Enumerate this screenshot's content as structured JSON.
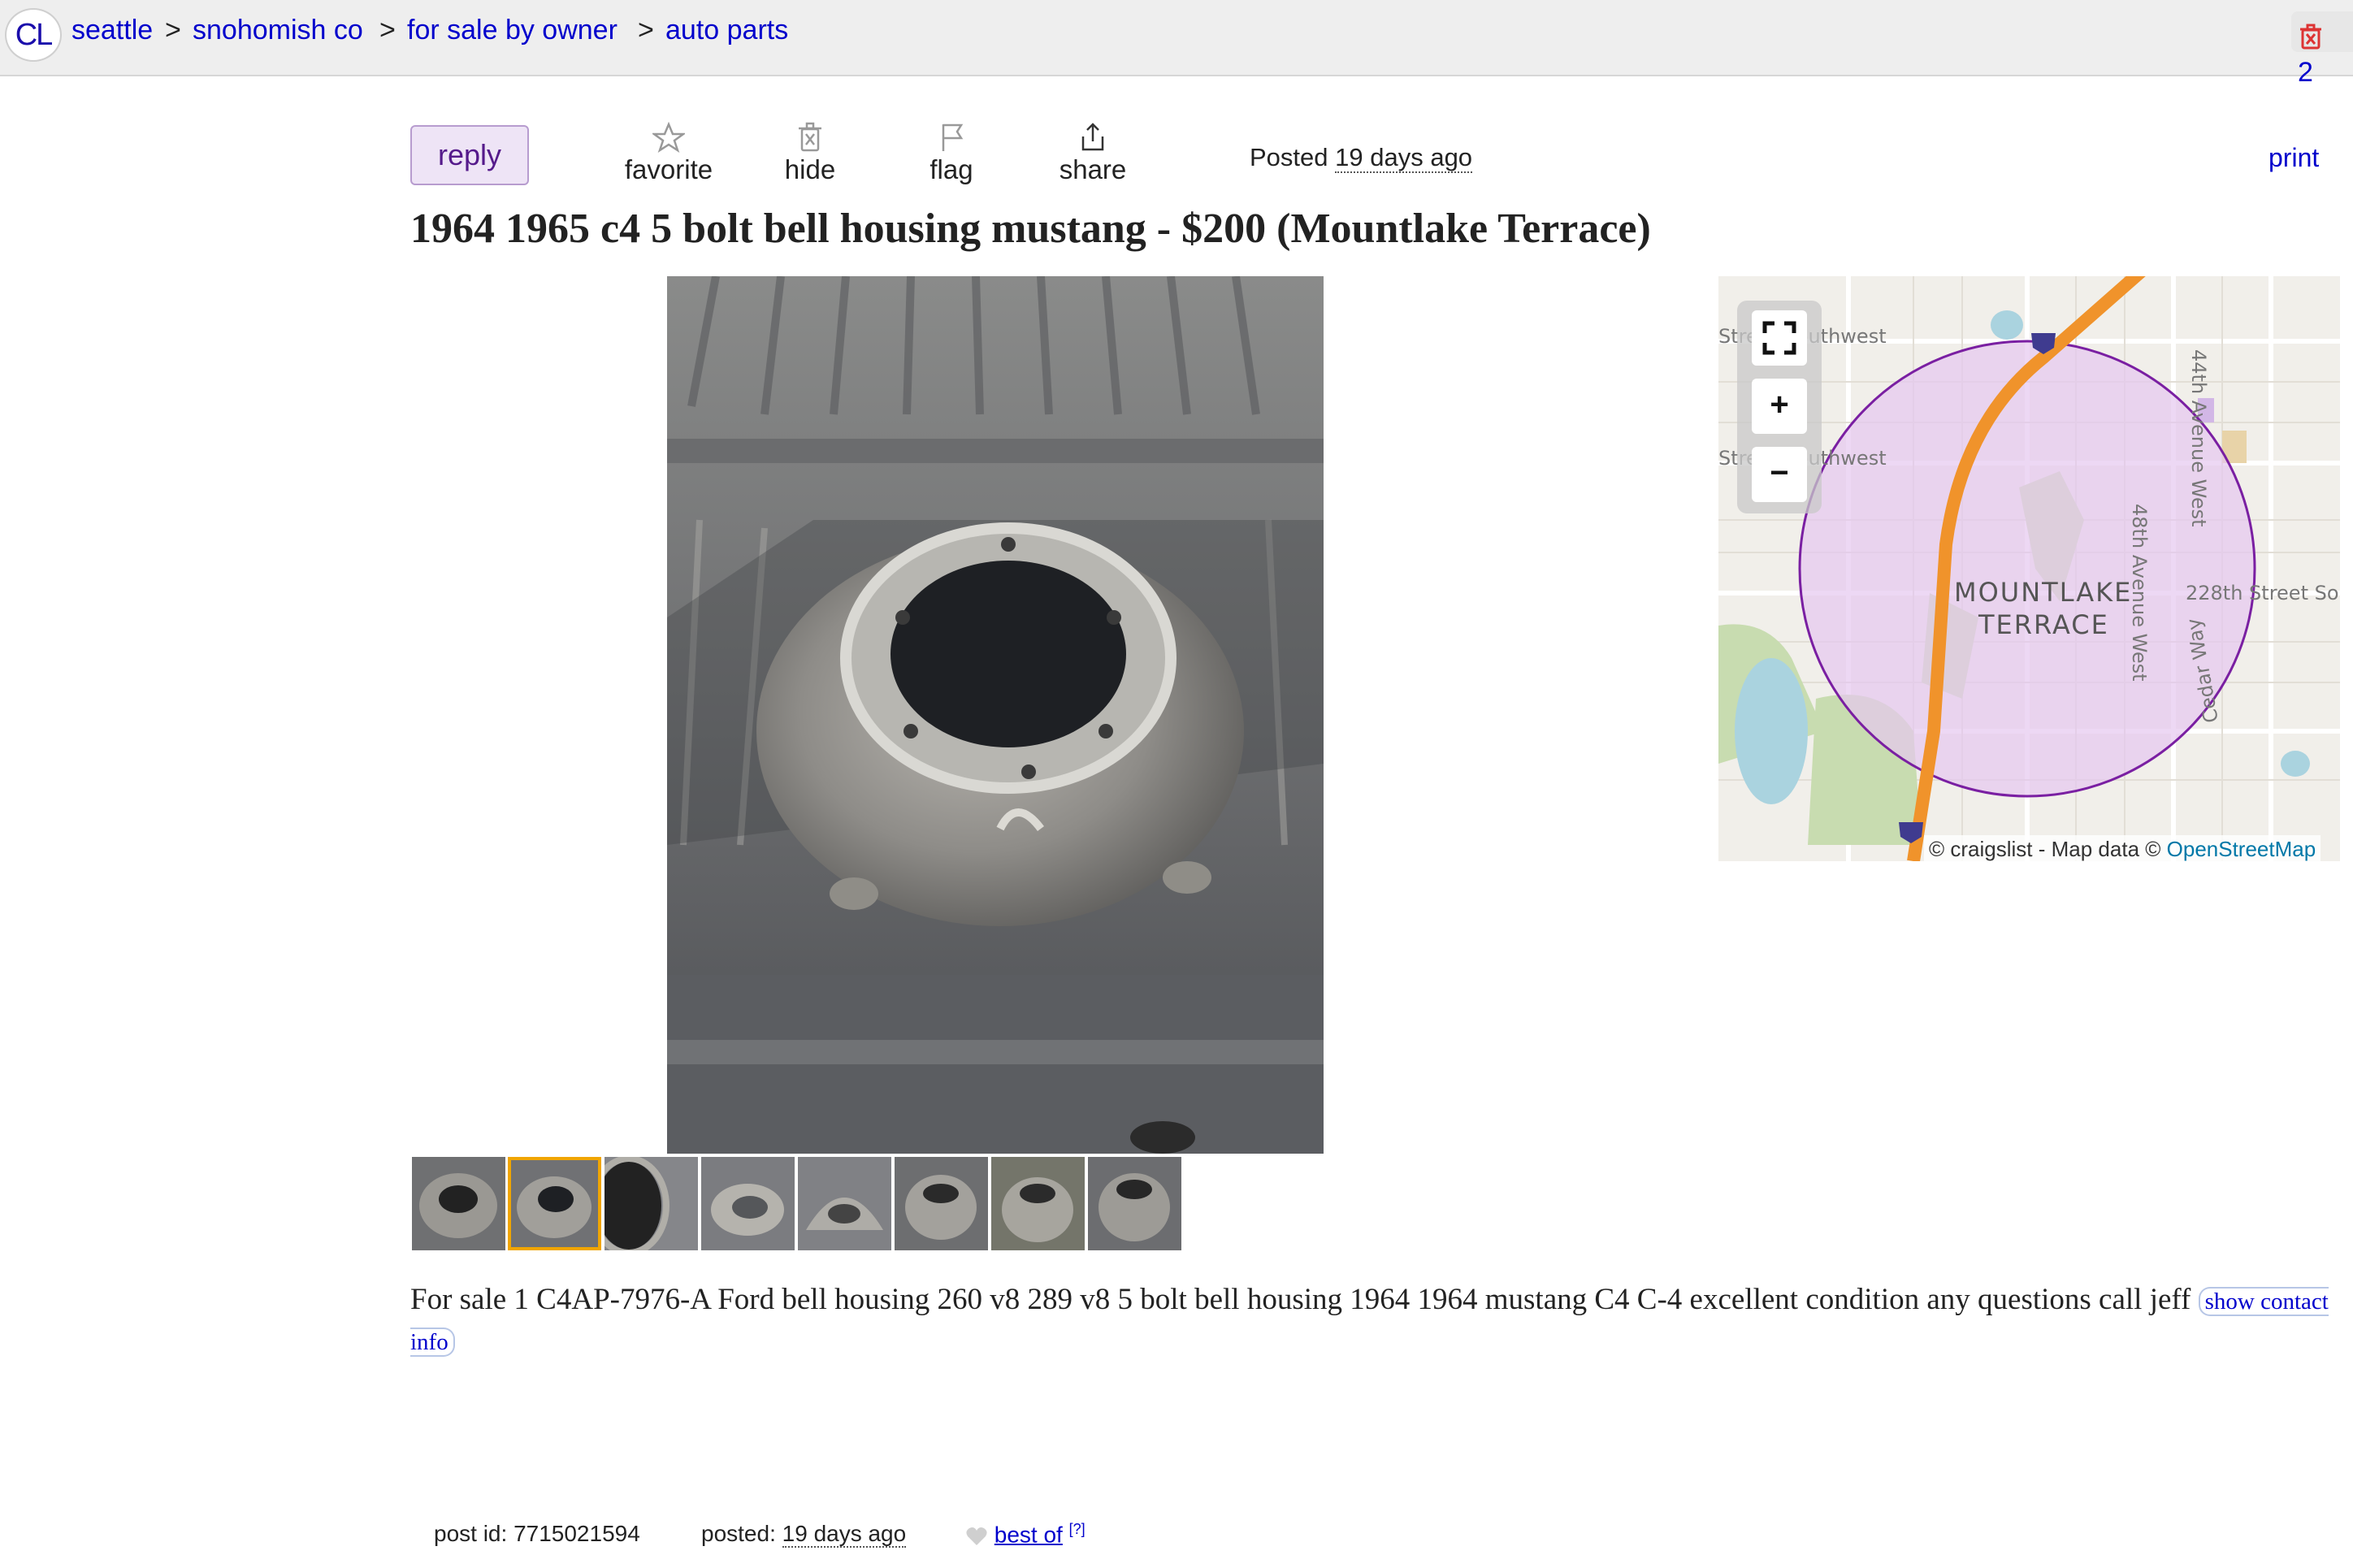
{
  "breadcrumbs": {
    "logo": "CL",
    "items": [
      "seattle",
      "snohomish co",
      "for sale by owner",
      "auto parts"
    ],
    "separator": ">",
    "favorites_count": "2"
  },
  "actions": {
    "reply": "reply",
    "favorite": "favorite",
    "hide": "hide",
    "flag": "flag",
    "share": "share",
    "posted_prefix": "Posted",
    "posted_when": "19 days ago",
    "print": "print"
  },
  "posting": {
    "title": "1964 1965 c4 5 bolt bell housing mustang - $200 (Mountlake Terrace)",
    "body": "For sale 1 C4AP-7976-A Ford bell housing 260 v8 289 v8 5 bolt bell housing 1964 1964 mustang C4 C-4 excellent condition any questions call jeff",
    "show_contact": "show contact info",
    "thumbnail_count": 8,
    "selected_thumbnail": 2
  },
  "map": {
    "labels": {
      "area": [
        "MOUNTLAKE",
        "TERRACE"
      ],
      "street_1": "Street Southwest",
      "street_2": "Street Southwest",
      "street_3": "228th Street So",
      "avenue_48": "48th Avenue West",
      "avenue_44": "44th Avenue West",
      "cedar_way": "Cedar Way",
      "interstate": "5"
    },
    "controls": {
      "fullscreen": "⛶",
      "zoom_in": "+",
      "zoom_out": "−"
    },
    "attribution_prefix": "© craigslist - Map data ©",
    "attribution_link": "OpenStreetMap",
    "colors": {
      "highway": "#f0932b",
      "circle_stroke": "#7a1fa2",
      "circle_fill": "#e6c8f0",
      "park": "#c8dcb0",
      "water": "#aad3df"
    }
  },
  "footer": {
    "post_id_label": "post id:",
    "post_id": "7715021594",
    "posted_label": "posted:",
    "posted_when": "19 days ago",
    "best_of": "best of",
    "best_of_help": "[?]"
  },
  "colors": {
    "link": "#0000cc",
    "reply_bg": "#eee4f6",
    "reply_text": "#551a8b",
    "topbar_bg": "#eeeeee",
    "thumb_selected": "#f0a500"
  }
}
